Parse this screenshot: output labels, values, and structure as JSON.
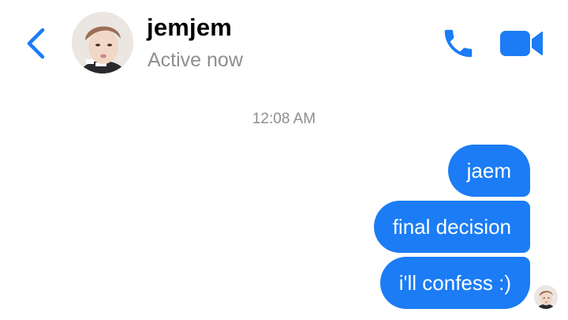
{
  "header": {
    "contact_name": "jemjem",
    "status": "Active now"
  },
  "icons": {
    "back": "chevron-left-icon",
    "call": "phone-icon",
    "video": "video-camera-icon"
  },
  "colors": {
    "accent": "#1B7CF5",
    "bubble_text": "#FFFFFF",
    "secondary_text": "#8E8E93"
  },
  "conversation": {
    "timestamp": "12:08 AM",
    "messages": [
      {
        "sender": "me",
        "text": "jaem"
      },
      {
        "sender": "me",
        "text": "final decision"
      },
      {
        "sender": "me",
        "text": "i'll confess :)"
      }
    ]
  }
}
